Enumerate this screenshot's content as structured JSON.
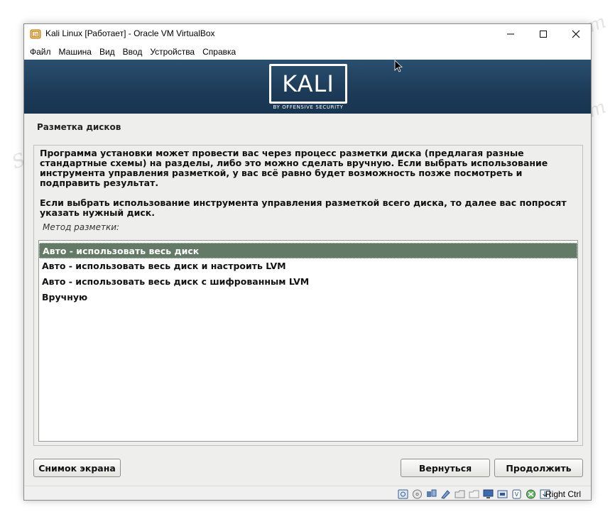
{
  "window": {
    "title": "Kali Linux [Работает] - Oracle VM VirtualBox"
  },
  "menu": [
    "Файл",
    "Машина",
    "Вид",
    "Ввод",
    "Устройства",
    "Справка"
  ],
  "banner": {
    "logo": "KALI",
    "subtitle": "BY OFFENSIVE SECURITY"
  },
  "installer": {
    "section_title": "Разметка дисков",
    "description_1": "Программа установки может провести вас через процесс разметки диска (предлагая разные стандартные схемы) на разделы, либо это можно сделать вручную. Если выбрать использование инструмента управления разметкой, у вас всё равно будет возможность позже посмотреть и подправить результат.",
    "description_2": "Если выбрать использование инструмента управления разметкой всего диска, то далее вас попросят указать нужный диск.",
    "method_label": "Метод разметки:",
    "options": [
      {
        "label": "Авто - использовать весь диск",
        "selected": true
      },
      {
        "label": "Авто - использовать весь диск и настроить LVM",
        "selected": false
      },
      {
        "label": "Авто - использовать весь диск с шифрованным LVM",
        "selected": false
      },
      {
        "label": "Вручную",
        "selected": false
      }
    ],
    "buttons": {
      "screenshot": "Снимок экрана",
      "back": "Вернуться",
      "continue": "Продолжить"
    }
  },
  "statusbar": {
    "host_key": "Right Ctrl",
    "icons": [
      "hard-disk-icon",
      "optical-disk-icon",
      "audio-icon",
      "network-icon",
      "usb-icon",
      "shared-folder-icon",
      "display-icon",
      "recording-icon",
      "cpu-icon",
      "mouse-integration-icon",
      "arrow-down-icon"
    ]
  },
  "watermark": "Soringpcrepair.Com",
  "colors": {
    "banner": "#1f4060",
    "selection": "#627a66",
    "window_bg": "#f0f0f0",
    "installer_bg": "#eeeeec"
  }
}
